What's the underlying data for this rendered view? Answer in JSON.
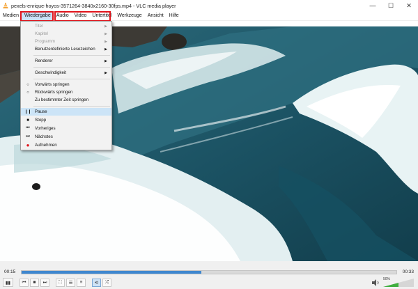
{
  "window": {
    "title": "pexels-enrique-hoyos-3571264-3840x2160-30fps.mp4 - VLC media player",
    "controls": {
      "minimize": "—",
      "maximize": "☐",
      "close": "✕"
    }
  },
  "menubar": {
    "items": [
      {
        "label": "Medien"
      },
      {
        "label": "Wiedergabe"
      },
      {
        "label": "Audio"
      },
      {
        "label": "Video"
      },
      {
        "label": "Untertitel"
      },
      {
        "label": "Werkzeuge"
      },
      {
        "label": "Ansicht"
      },
      {
        "label": "Hilfe"
      }
    ]
  },
  "playback_menu": {
    "items": [
      {
        "label": "Titel",
        "disabled": true,
        "submenu": true
      },
      {
        "label": "Kapitel",
        "disabled": true,
        "submenu": true
      },
      {
        "label": "Programm",
        "disabled": true,
        "submenu": true
      },
      {
        "label": "Benutzerdefinierte Lesezeichen",
        "submenu": true
      },
      {
        "label": "Renderer",
        "submenu": true
      },
      {
        "label": "Geschwindigkeit",
        "submenu": true
      },
      {
        "label": "Vorwärts springen",
        "icon": "forward-icon"
      },
      {
        "label": "Rückwärts springen",
        "icon": "backward-icon"
      },
      {
        "label": "Zu bestimmter Zeit springen"
      },
      {
        "label": "Pause",
        "icon": "pause-icon",
        "selected": true
      },
      {
        "label": "Stopp",
        "icon": "stop-icon"
      },
      {
        "label": "Vorheriges",
        "icon": "previous-icon"
      },
      {
        "label": "Nächstes",
        "icon": "next-icon"
      },
      {
        "label": "Aufnehmen",
        "icon": "record-icon"
      }
    ]
  },
  "player": {
    "elapsed": "00:15",
    "total": "00:33",
    "progress": 0.48,
    "volume_label": "50%",
    "volume_level": 0.5,
    "buttons": {
      "play": "▮▮",
      "previous": "⏮",
      "stop": "■",
      "next": "⏭",
      "fullscreen": "⛶",
      "extended": "☰",
      "playlist": "≡",
      "loop": "⟲",
      "shuffle": "⤮"
    }
  },
  "colors": {
    "highlight_box": "#e0141b",
    "seek_fill": "#3f87cf",
    "menu_selected": "#cce4f7"
  }
}
